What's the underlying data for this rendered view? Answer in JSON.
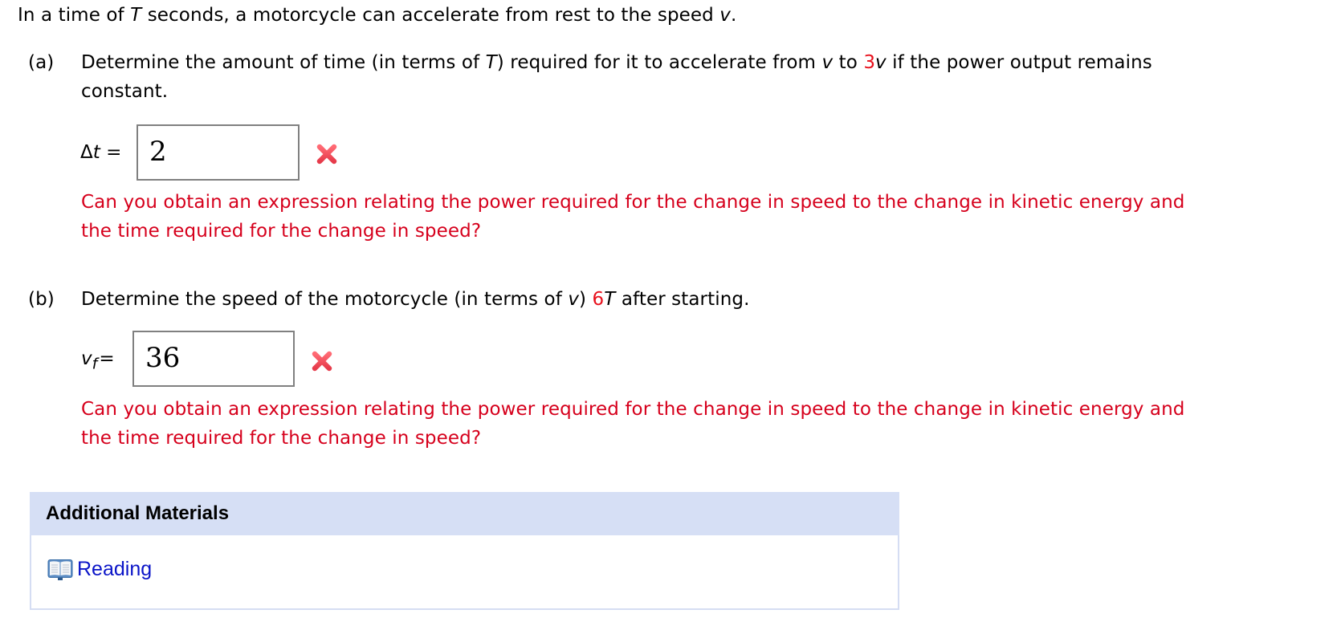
{
  "intro": {
    "prefix": "In a time of ",
    "var_T": "T",
    "middle": " seconds, a motorcycle can accelerate from rest to the speed ",
    "var_v": "v",
    "suffix": "."
  },
  "part_a": {
    "label": "(a)",
    "question_line1_prefix": "Determine the amount of time (in terms of ",
    "question_var_T": "T",
    "question_line1_mid": ") required for it to accelerate from ",
    "question_var_v1": "v",
    "question_to": " to ",
    "question_coeff_red": "3",
    "question_var_v2": "v",
    "question_line1_suffix": " if the power output remains",
    "question_line2": "constant.",
    "answer_label_symbol": "Δ",
    "answer_label_var": "t",
    "answer_label_eq": " =",
    "answer_value": "2",
    "answer_status": "incorrect",
    "hint_line1": "Can you obtain an expression relating the power required for the change in speed to the change in kinetic energy and",
    "hint_line2": "the time required for the change in speed?"
  },
  "part_b": {
    "label": "(b)",
    "question_prefix": "Determine the speed of the motorcycle (in terms of ",
    "question_var_v": "v",
    "question_mid": ") ",
    "question_coeff_red": "6",
    "question_var_T": "T",
    "question_suffix": " after starting.",
    "answer_label_var": "v",
    "answer_label_sub": "f",
    "answer_label_eq": "=",
    "answer_value": "36",
    "answer_status": "incorrect",
    "hint_line1": "Can you obtain an expression relating the power required for the change in speed to the change in kinetic energy and",
    "hint_line2": "the time required for the change in speed?"
  },
  "additional_materials": {
    "title": "Additional Materials",
    "links": [
      {
        "label": "Reading",
        "icon": "book-icon"
      }
    ]
  },
  "colors": {
    "highlight_red": "#e8101c",
    "hint_red": "#d6001c",
    "incorrect_mark": "#f04a58",
    "materials_header_bg": "#d6dff5",
    "link_blue": "#0a14c8"
  }
}
